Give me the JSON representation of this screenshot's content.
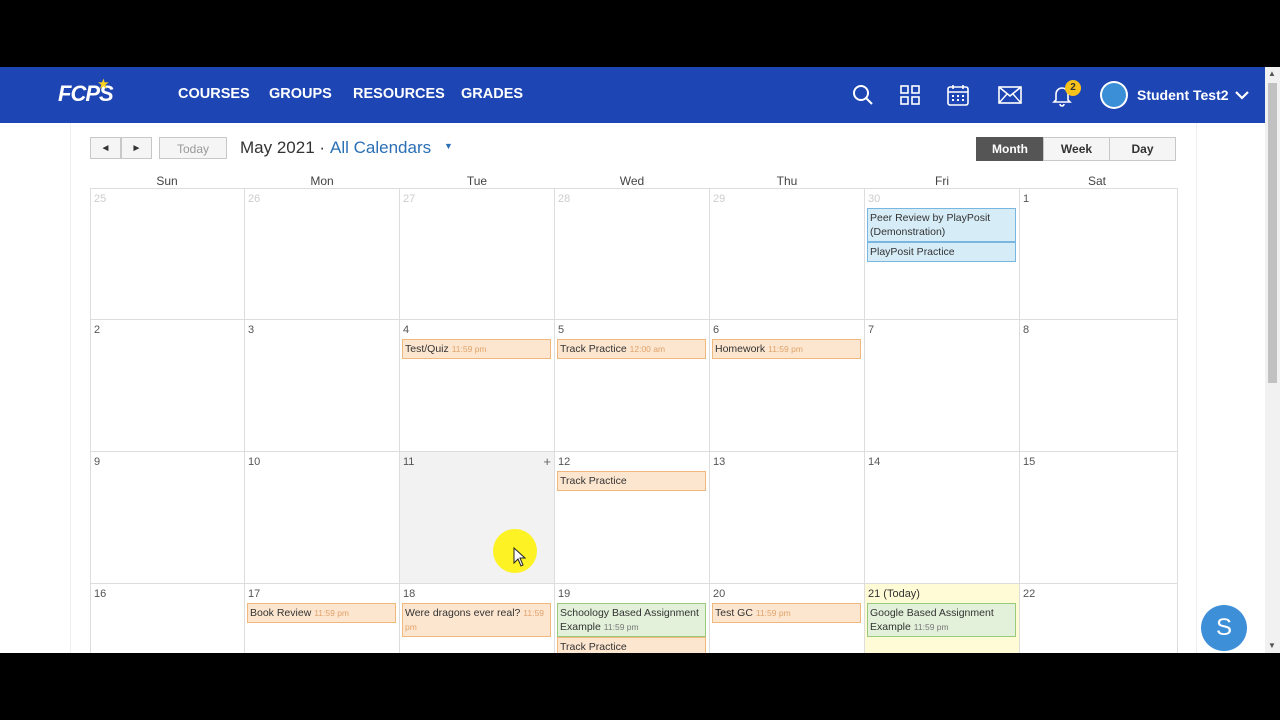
{
  "header": {
    "logo": "FCPS",
    "nav": [
      "COURSES",
      "GROUPS",
      "RESOURCES",
      "GRADES"
    ],
    "notification_count": "2",
    "user_name": "Student Test2",
    "icons": [
      "search-icon",
      "apps-grid-icon",
      "calendar-icon",
      "mail-icon",
      "bell-icon",
      "chevron-down-icon"
    ]
  },
  "toolbar": {
    "prev": "◄",
    "next": "►",
    "today": "Today",
    "month_year": "May 2021 ·",
    "calendar_filter": "All Calendars",
    "filter_caret": "▼",
    "views": [
      "Month",
      "Week",
      "Day"
    ],
    "active_view": "Month"
  },
  "days_of_week": [
    "Sun",
    "Mon",
    "Tue",
    "Wed",
    "Thu",
    "Fri",
    "Sat"
  ],
  "weeks": [
    [
      {
        "num": "25",
        "other": true,
        "events": []
      },
      {
        "num": "26",
        "other": true,
        "events": []
      },
      {
        "num": "27",
        "other": true,
        "events": []
      },
      {
        "num": "28",
        "other": true,
        "events": []
      },
      {
        "num": "29",
        "other": true,
        "events": []
      },
      {
        "num": "30",
        "other": true,
        "events": [
          {
            "title": "Peer Review by PlayPosit (Demonstration)",
            "time": "",
            "color": "blue"
          },
          {
            "title": "PlayPosit Practice",
            "time": "",
            "color": "blue"
          }
        ]
      },
      {
        "num": "1",
        "events": []
      }
    ],
    [
      {
        "num": "2",
        "events": []
      },
      {
        "num": "3",
        "events": []
      },
      {
        "num": "4",
        "events": [
          {
            "title": "Test/Quiz",
            "time": "11:59 pm",
            "color": "orange"
          }
        ]
      },
      {
        "num": "5",
        "events": [
          {
            "title": "Track Practice",
            "time": "12:00 am",
            "color": "orange"
          }
        ]
      },
      {
        "num": "6",
        "events": [
          {
            "title": "Homework",
            "time": "11:59 pm",
            "color": "orange"
          }
        ]
      },
      {
        "num": "7",
        "events": []
      },
      {
        "num": "8",
        "events": []
      }
    ],
    [
      {
        "num": "9",
        "events": []
      },
      {
        "num": "10",
        "events": []
      },
      {
        "num": "11",
        "hover": true,
        "events": []
      },
      {
        "num": "12",
        "events": [
          {
            "title": "Track Practice",
            "time": "",
            "color": "orange"
          }
        ]
      },
      {
        "num": "13",
        "events": []
      },
      {
        "num": "14",
        "events": []
      },
      {
        "num": "15",
        "events": []
      }
    ],
    [
      {
        "num": "16",
        "events": []
      },
      {
        "num": "17",
        "events": [
          {
            "title": "Book Review",
            "time": "11:59 pm",
            "color": "orange"
          }
        ]
      },
      {
        "num": "18",
        "events": [
          {
            "title": "Were dragons ever real?",
            "time": "11:59 pm",
            "color": "orange"
          }
        ]
      },
      {
        "num": "19",
        "events": [
          {
            "title": "Schoology Based Assignment Example",
            "time": "11:59 pm",
            "color": "green"
          },
          {
            "title": "Track Practice",
            "time": "",
            "color": "orange"
          }
        ]
      },
      {
        "num": "20",
        "events": [
          {
            "title": "Test GC",
            "time": "11:59 pm",
            "color": "orange"
          }
        ]
      },
      {
        "num": "21 (Today)",
        "today": true,
        "events": [
          {
            "title": "Google Based Assignment Example",
            "time": "11:59 pm",
            "color": "green"
          }
        ]
      },
      {
        "num": "22",
        "events": []
      }
    ]
  ],
  "add_event_glyph": "+",
  "fab_label": "S"
}
